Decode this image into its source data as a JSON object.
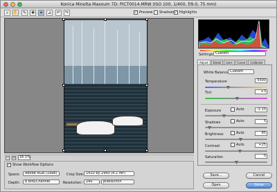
{
  "window": {
    "title": "Konica Minolta Maxxum 7D:  PICT0014.MRW  (ISO 100, 1/400, f/9.0, 75 mm)"
  },
  "toolbar": {
    "tools": [
      {
        "name": "zoom-tool",
        "icon": "⌕"
      },
      {
        "name": "hand-tool",
        "icon": "✋"
      },
      {
        "name": "white-balance-tool",
        "icon": "✎"
      },
      {
        "name": "color-sampler-tool",
        "icon": "✚"
      },
      {
        "name": "crop-tool",
        "icon": "⌗"
      },
      {
        "name": "straighten-tool",
        "icon": "⊿"
      },
      {
        "name": "rotate-left-tool",
        "icon": "↶"
      },
      {
        "name": "rotate-right-tool",
        "icon": "↷"
      }
    ],
    "preview_label": "Preview",
    "shadows_label": "Shadows",
    "highlights_label": "Highlights"
  },
  "zoom": {
    "minus": "−",
    "plus": "+",
    "value": "16.1%"
  },
  "workflow": {
    "title": "Show Workflow Options",
    "space_label": "Space:",
    "space_value": "Adobe RGB (1998)",
    "size_label": "Crop Size:",
    "size_value": "1410 by 2940 (4.1 MP)",
    "depth_label": "Depth:",
    "depth_value": "8 Bits/Channel",
    "resolution_label": "Resolution:",
    "resolution_value": "240",
    "resolution_unit": "pixels/inch"
  },
  "settings": {
    "label": "Settings:",
    "value": "Custom"
  },
  "tabs": [
    "Adjust",
    "Detail",
    "Lens",
    "Curve",
    "Calibrate"
  ],
  "adjust": {
    "white_balance_label": "White Balance:",
    "white_balance_value": "Custom",
    "temperature_label": "Temperature",
    "temperature_value": "5500",
    "tint_label": "Tint",
    "tint_value": "+3",
    "exposure_label": "Exposure",
    "exposure_value": "-1.15",
    "shadows_label": "Shadows",
    "shadows_value": "5",
    "brightness_label": "Brightness",
    "brightness_value": "85",
    "contrast_label": "Contrast",
    "contrast_value": "+25",
    "saturation_label": "Saturation",
    "saturation_value": "0",
    "auto_label": "Auto"
  },
  "buttons": {
    "save": "Save...",
    "cancel": "Cancel",
    "open": "Open",
    "done": "Done"
  },
  "colors": {
    "primary_button": "#4e84d4",
    "histogram_background": "#000000"
  }
}
